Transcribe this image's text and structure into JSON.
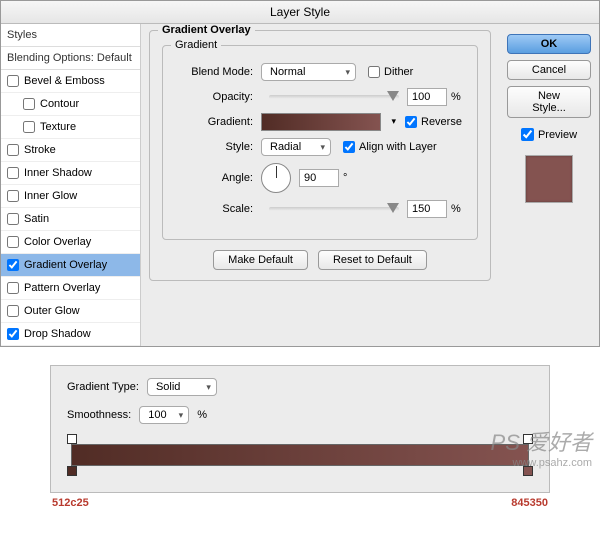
{
  "title": "Layer Style",
  "sidebar": {
    "header1": "Styles",
    "header2": "Blending Options: Default",
    "items": [
      {
        "label": "Bevel & Emboss",
        "checked": false,
        "indent": false
      },
      {
        "label": "Contour",
        "checked": false,
        "indent": true
      },
      {
        "label": "Texture",
        "checked": false,
        "indent": true
      },
      {
        "label": "Stroke",
        "checked": false,
        "indent": false
      },
      {
        "label": "Inner Shadow",
        "checked": false,
        "indent": false
      },
      {
        "label": "Inner Glow",
        "checked": false,
        "indent": false
      },
      {
        "label": "Satin",
        "checked": false,
        "indent": false
      },
      {
        "label": "Color Overlay",
        "checked": false,
        "indent": false
      },
      {
        "label": "Gradient Overlay",
        "checked": true,
        "indent": false,
        "active": true
      },
      {
        "label": "Pattern Overlay",
        "checked": false,
        "indent": false
      },
      {
        "label": "Outer Glow",
        "checked": false,
        "indent": false
      },
      {
        "label": "Drop Shadow",
        "checked": true,
        "indent": false
      }
    ]
  },
  "panel": {
    "group_title": "Gradient Overlay",
    "inner_title": "Gradient",
    "blend_label": "Blend Mode:",
    "blend_value": "Normal",
    "dither_label": "Dither",
    "opacity_label": "Opacity:",
    "opacity_value": "100",
    "gradient_label": "Gradient:",
    "reverse_label": "Reverse",
    "style_label": "Style:",
    "style_value": "Radial",
    "align_label": "Align with Layer",
    "angle_label": "Angle:",
    "angle_value": "90",
    "scale_label": "Scale:",
    "scale_value": "150",
    "make_default": "Make Default",
    "reset_default": "Reset to Default"
  },
  "right": {
    "ok": "OK",
    "cancel": "Cancel",
    "new_style": "New Style...",
    "preview": "Preview"
  },
  "bottom": {
    "type_label": "Gradient Type:",
    "type_value": "Solid",
    "smooth_label": "Smoothness:",
    "smooth_value": "100",
    "color_left": "512c25",
    "color_right": "845350"
  },
  "watermark": {
    "line1": "PS 爱好者",
    "line2": "www.psahz.com"
  },
  "chart_data": {
    "type": "gradient",
    "stops": [
      {
        "pos": 0,
        "color": "#512c25"
      },
      {
        "pos": 100,
        "color": "#845350"
      }
    ]
  }
}
